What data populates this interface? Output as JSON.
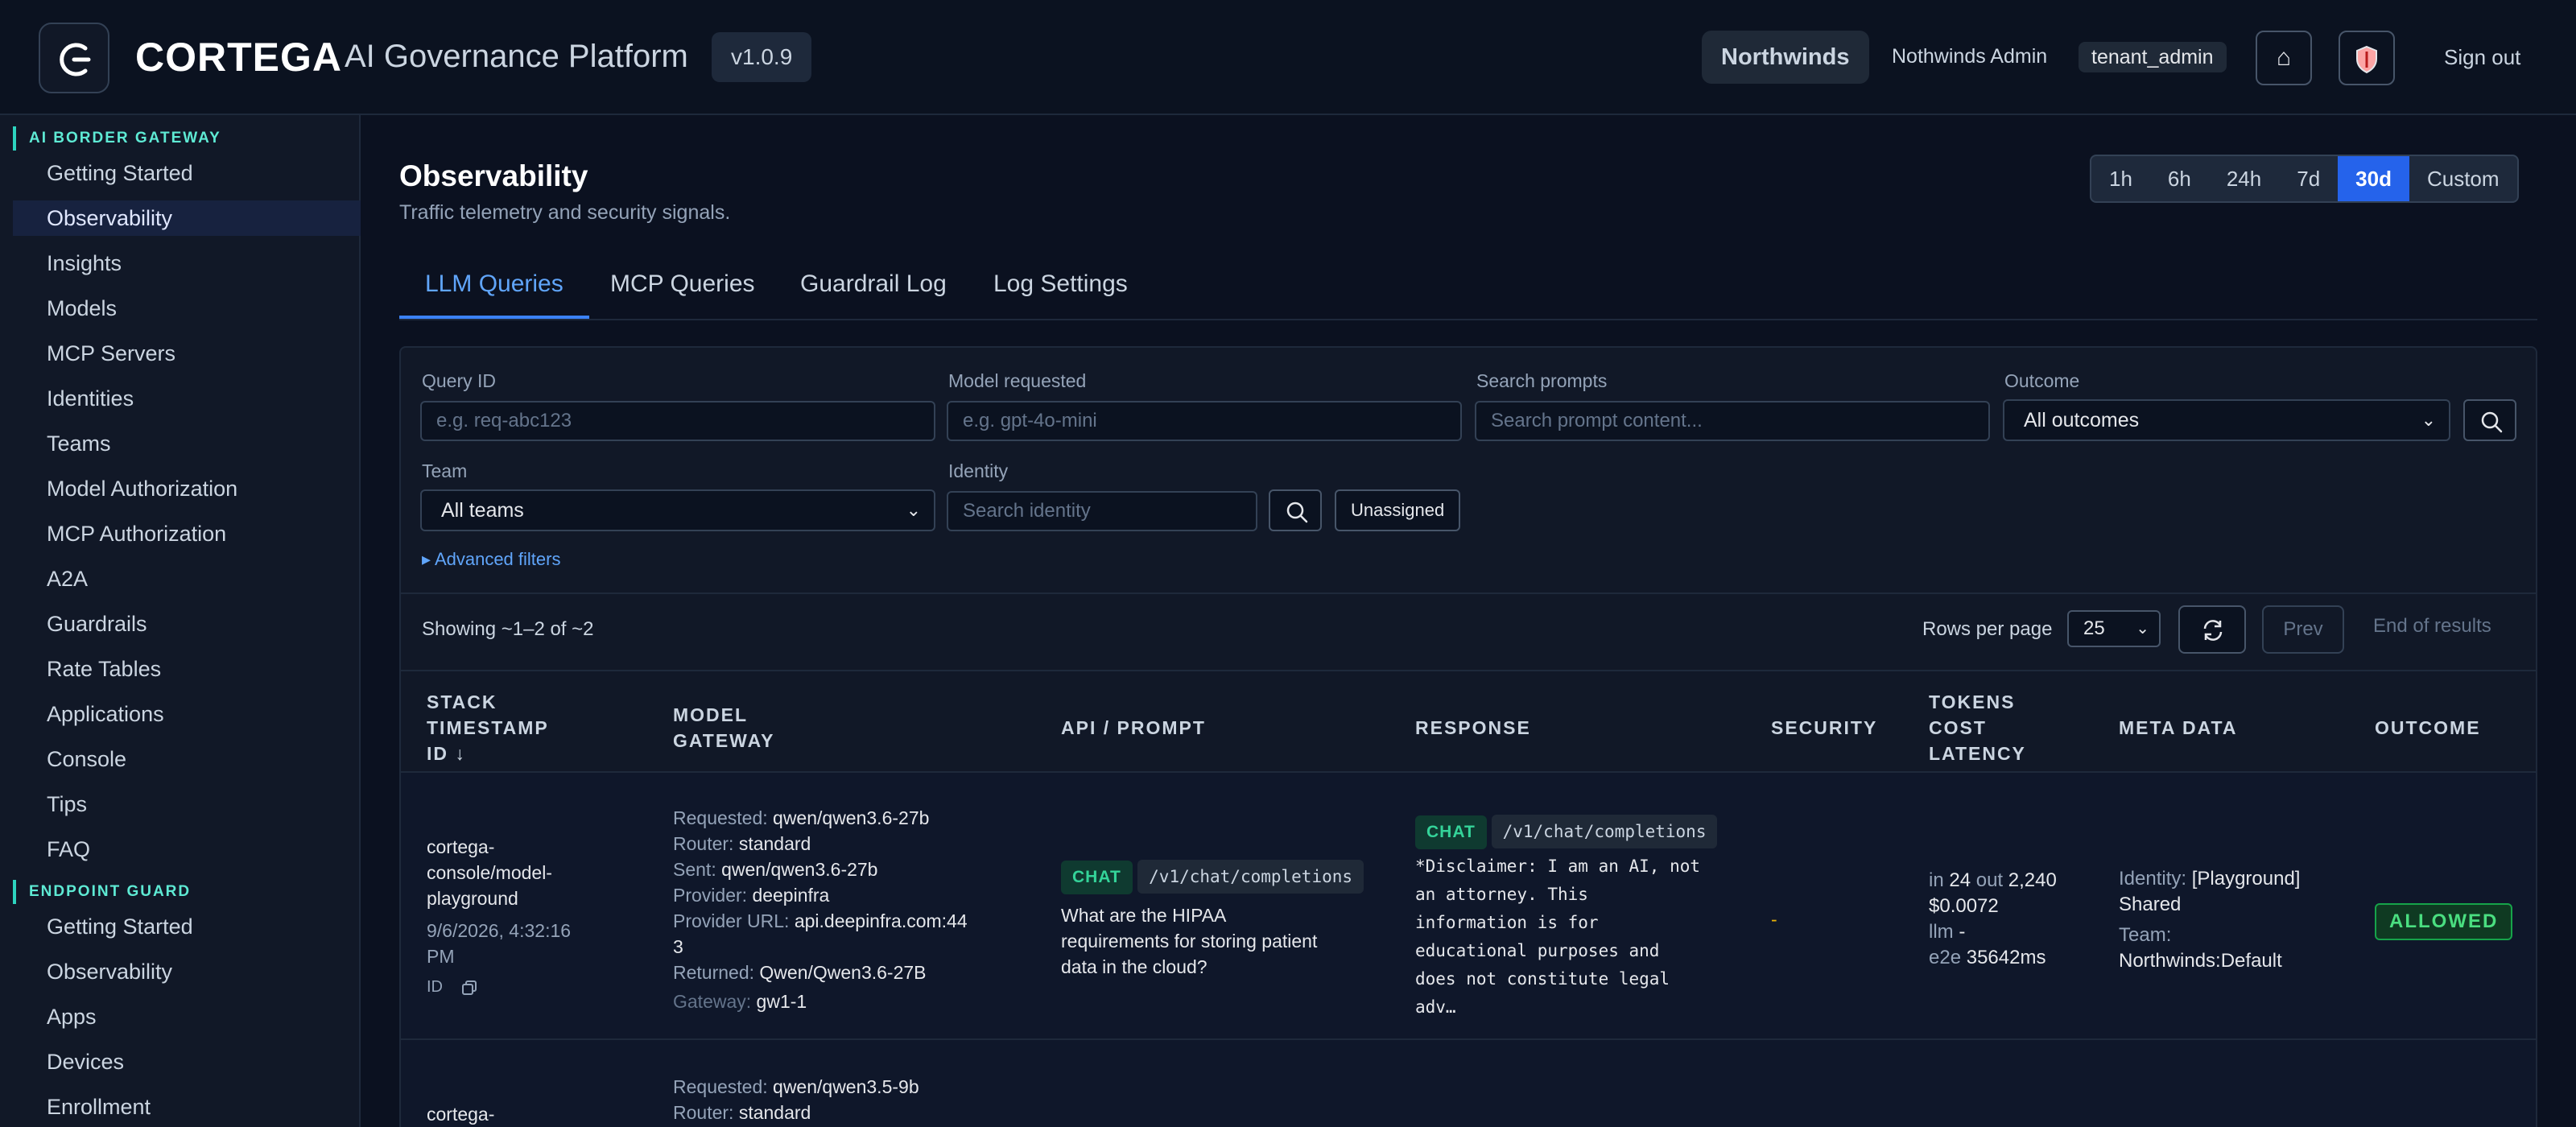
{
  "header": {
    "brand": "CORTEGA",
    "subtitle": "AI Governance Platform",
    "version": "v1.0.9",
    "tenant": "Northwinds",
    "user": "Nothwinds Admin",
    "role": "tenant_admin",
    "home_icon": "home-icon",
    "shield_icon": "shield-icon",
    "signout": "Sign out"
  },
  "sidebar": {
    "section1": "AI BORDER GATEWAY",
    "items1": [
      "Getting Started",
      "Observability",
      "Insights",
      "Models",
      "MCP Servers",
      "Identities",
      "Teams",
      "Model Authorization",
      "MCP Authorization",
      "A2A",
      "Guardrails",
      "Rate Tables",
      "Applications",
      "Console",
      "Tips",
      "FAQ"
    ],
    "section2": "ENDPOINT GUARD",
    "items2": [
      "Getting Started",
      "Observability",
      "Apps",
      "Devices",
      "Enrollment"
    ]
  },
  "page": {
    "title": "Observability",
    "subtitle": "Traffic telemetry and security signals.",
    "ranges": [
      "1h",
      "6h",
      "24h",
      "7d",
      "30d",
      "Custom"
    ],
    "active_range": "30d",
    "tabs": [
      "LLM Queries",
      "MCP Queries",
      "Guardrail Log",
      "Log Settings"
    ]
  },
  "filters": {
    "query_id_label": "Query ID",
    "query_id_placeholder": "e.g. req-abc123",
    "model_label": "Model requested",
    "model_placeholder": "e.g. gpt-4o-mini",
    "prompts_label": "Search prompts",
    "prompts_placeholder": "Search prompt content...",
    "outcome_label": "Outcome",
    "outcome_value": "All outcomes",
    "team_label": "Team",
    "team_value": "All teams",
    "identity_label": "Identity",
    "identity_placeholder": "Search identity",
    "unassigned": "Unassigned",
    "advanced": "▸ Advanced filters"
  },
  "results": {
    "showing": "Showing ~1–2 of ~2",
    "rows_per_page_label": "Rows per page",
    "rows_per_page": "25",
    "prev": "Prev",
    "end": "End of results"
  },
  "table": {
    "headers": {
      "stack": [
        "STACK",
        "TIMESTAMP",
        "ID ↓"
      ],
      "model": [
        "MODEL",
        "GATEWAY"
      ],
      "api": "API / PROMPT",
      "response": "RESPONSE",
      "security": "SECURITY",
      "tokens": [
        "TOKENS",
        "COST",
        "LATENCY"
      ],
      "meta": "META DATA",
      "outcome": "OUTCOME"
    },
    "rows": [
      {
        "stack": [
          "cortega-",
          "console/model-",
          "playground"
        ],
        "timestamp": [
          "9/6/2026, 4:32:16",
          "PM"
        ],
        "id_label": "ID",
        "requested_label": "Requested:",
        "requested": "qwen/qwen3.6-27b",
        "router_label": "Router:",
        "router": "standard",
        "sent_label": "Sent:",
        "sent": "qwen/qwen3.6-27b",
        "provider_label": "Provider:",
        "provider": "deepinfra",
        "provider_url_label": "Provider URL:",
        "provider_url": "api.deepinfra.com:44",
        "provider_url_cont": "3",
        "returned_label": "Returned:",
        "returned": "Qwen/Qwen3.6-27B",
        "gateway_label": "Gateway:",
        "gateway": "gw1-1",
        "api_type": "CHAT",
        "api_path": "/v1/chat/completions",
        "prompt": [
          "What are the HIPAA",
          "requirements for storing patient",
          "data in the cloud?"
        ],
        "resp_type": "CHAT",
        "resp_path": "/v1/chat/completions",
        "response": [
          "*Disclaimer: I am an AI, not",
          "an attorney. This",
          "information is for",
          "educational purposes and",
          "does not constitute legal",
          "adv…"
        ],
        "security": "-",
        "tokens_in_label": "in",
        "tokens_in": "24",
        "tokens_out_label": "out",
        "tokens_out": "2,240",
        "cost": "$0.0072",
        "llm_label": "llm",
        "llm": "-",
        "e2e_label": "e2e",
        "e2e": "35642ms",
        "identity_label": "Identity:",
        "identity": "[Playground]",
        "identity_cont": "Shared",
        "team_label": "Team:",
        "team": "Northwinds:Default",
        "outcome": "ALLOWED"
      },
      {
        "stack": [
          "cortega-"
        ],
        "requested_label": "Requested:",
        "requested": "qwen/qwen3.5-9b",
        "router_label": "Router:",
        "router": "standard"
      }
    ]
  }
}
